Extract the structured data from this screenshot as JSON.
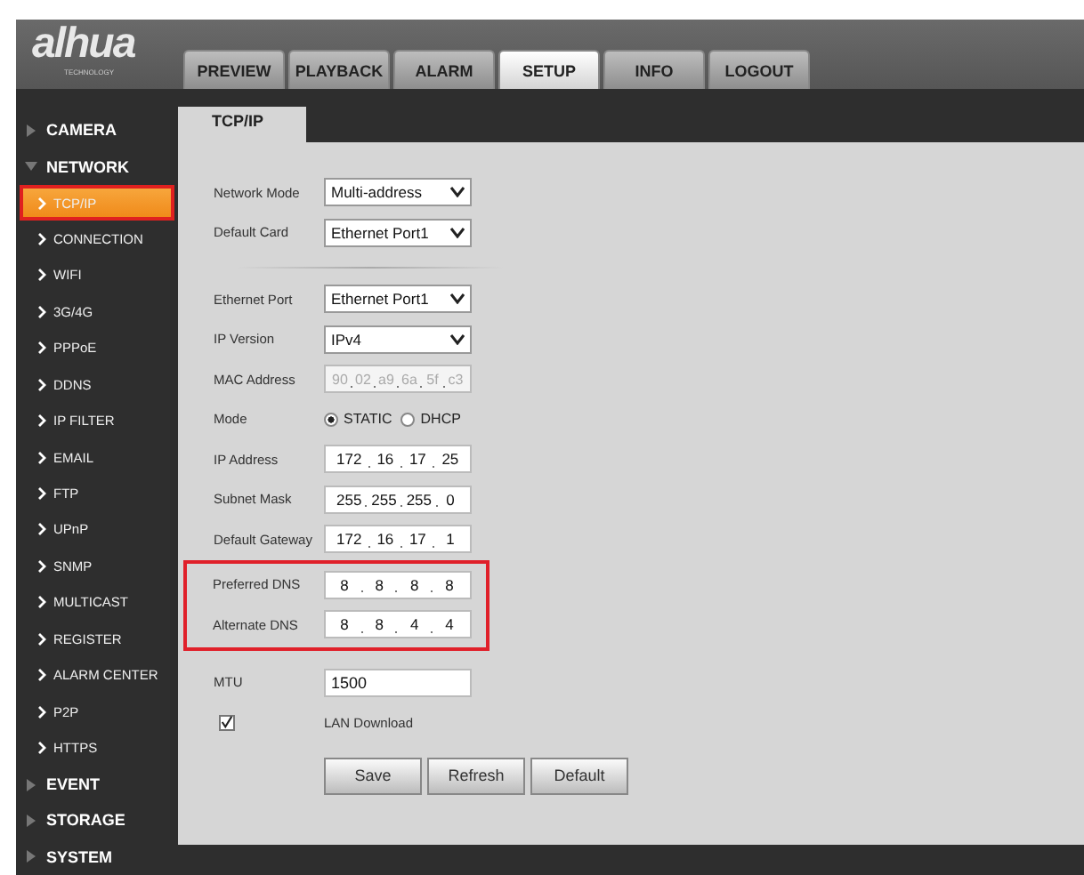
{
  "logo": {
    "text": "alhua",
    "subtitle": "TECHNOLOGY"
  },
  "tabs": [
    {
      "label": "PREVIEW",
      "selected": false
    },
    {
      "label": "PLAYBACK",
      "selected": false
    },
    {
      "label": "ALARM",
      "selected": false
    },
    {
      "label": "SETUP",
      "selected": true
    },
    {
      "label": "INFO",
      "selected": false
    },
    {
      "label": "LOGOUT",
      "selected": false
    }
  ],
  "sidebar": {
    "items": [
      {
        "label": "CAMERA",
        "expanded": false
      },
      {
        "label": "NETWORK",
        "expanded": true,
        "children": [
          {
            "label": "TCP/IP",
            "selected": true
          },
          {
            "label": "CONNECTION",
            "selected": false
          },
          {
            "label": "WIFI",
            "selected": false
          },
          {
            "label": "3G/4G",
            "selected": false
          },
          {
            "label": "PPPoE",
            "selected": false
          },
          {
            "label": "DDNS",
            "selected": false
          },
          {
            "label": "IP FILTER",
            "selected": false
          },
          {
            "label": "EMAIL",
            "selected": false
          },
          {
            "label": "FTP",
            "selected": false
          },
          {
            "label": "UPnP",
            "selected": false
          },
          {
            "label": "SNMP",
            "selected": false
          },
          {
            "label": "MULTICAST",
            "selected": false
          },
          {
            "label": "REGISTER",
            "selected": false
          },
          {
            "label": "ALARM CENTER",
            "selected": false
          },
          {
            "label": "P2P",
            "selected": false
          },
          {
            "label": "HTTPS",
            "selected": false
          }
        ]
      },
      {
        "label": "EVENT",
        "expanded": false
      },
      {
        "label": "STORAGE",
        "expanded": false
      },
      {
        "label": "SYSTEM",
        "expanded": false
      }
    ]
  },
  "page_tab": "TCP/IP",
  "form": [
    {
      "kind": "select",
      "label": "Network Mode",
      "value": "Multi-address"
    },
    {
      "kind": "select",
      "label": "Default Card",
      "value": "Ethernet Port1"
    },
    {
      "kind": "divider"
    },
    {
      "kind": "select",
      "label": "Ethernet Port",
      "value": "Ethernet Port1"
    },
    {
      "kind": "select",
      "label": "IP Version",
      "value": "IPv4"
    },
    {
      "kind": "mac",
      "label": "MAC Address",
      "segments": [
        "90",
        "02",
        "a9",
        "6a",
        "5f",
        "c3"
      ],
      "disabled": true
    },
    {
      "kind": "radio",
      "label": "Mode",
      "options": [
        {
          "label": "STATIC",
          "selected": true
        },
        {
          "label": "DHCP",
          "selected": false
        }
      ]
    },
    {
      "kind": "ip",
      "label": "IP Address",
      "segments": [
        "172",
        "16",
        "17",
        "25"
      ]
    },
    {
      "kind": "ip",
      "label": "Subnet Mask",
      "segments": [
        "255",
        "255",
        "255",
        "0"
      ]
    },
    {
      "kind": "ip",
      "label": "Default Gateway",
      "segments": [
        "172",
        "16",
        "17",
        "1"
      ]
    },
    {
      "kind": "ip",
      "label": "Preferred DNS",
      "segments": [
        "8",
        "8",
        "8",
        "8"
      ],
      "highlighted": true
    },
    {
      "kind": "ip",
      "label": "Alternate DNS",
      "segments": [
        "8",
        "8",
        "4",
        "4"
      ],
      "highlighted": true
    },
    {
      "kind": "text",
      "label": "MTU",
      "value": "1500"
    },
    {
      "kind": "checkbox",
      "label": "LAN Download",
      "checked": true
    }
  ],
  "buttons": [
    "Save",
    "Refresh",
    "Default"
  ]
}
